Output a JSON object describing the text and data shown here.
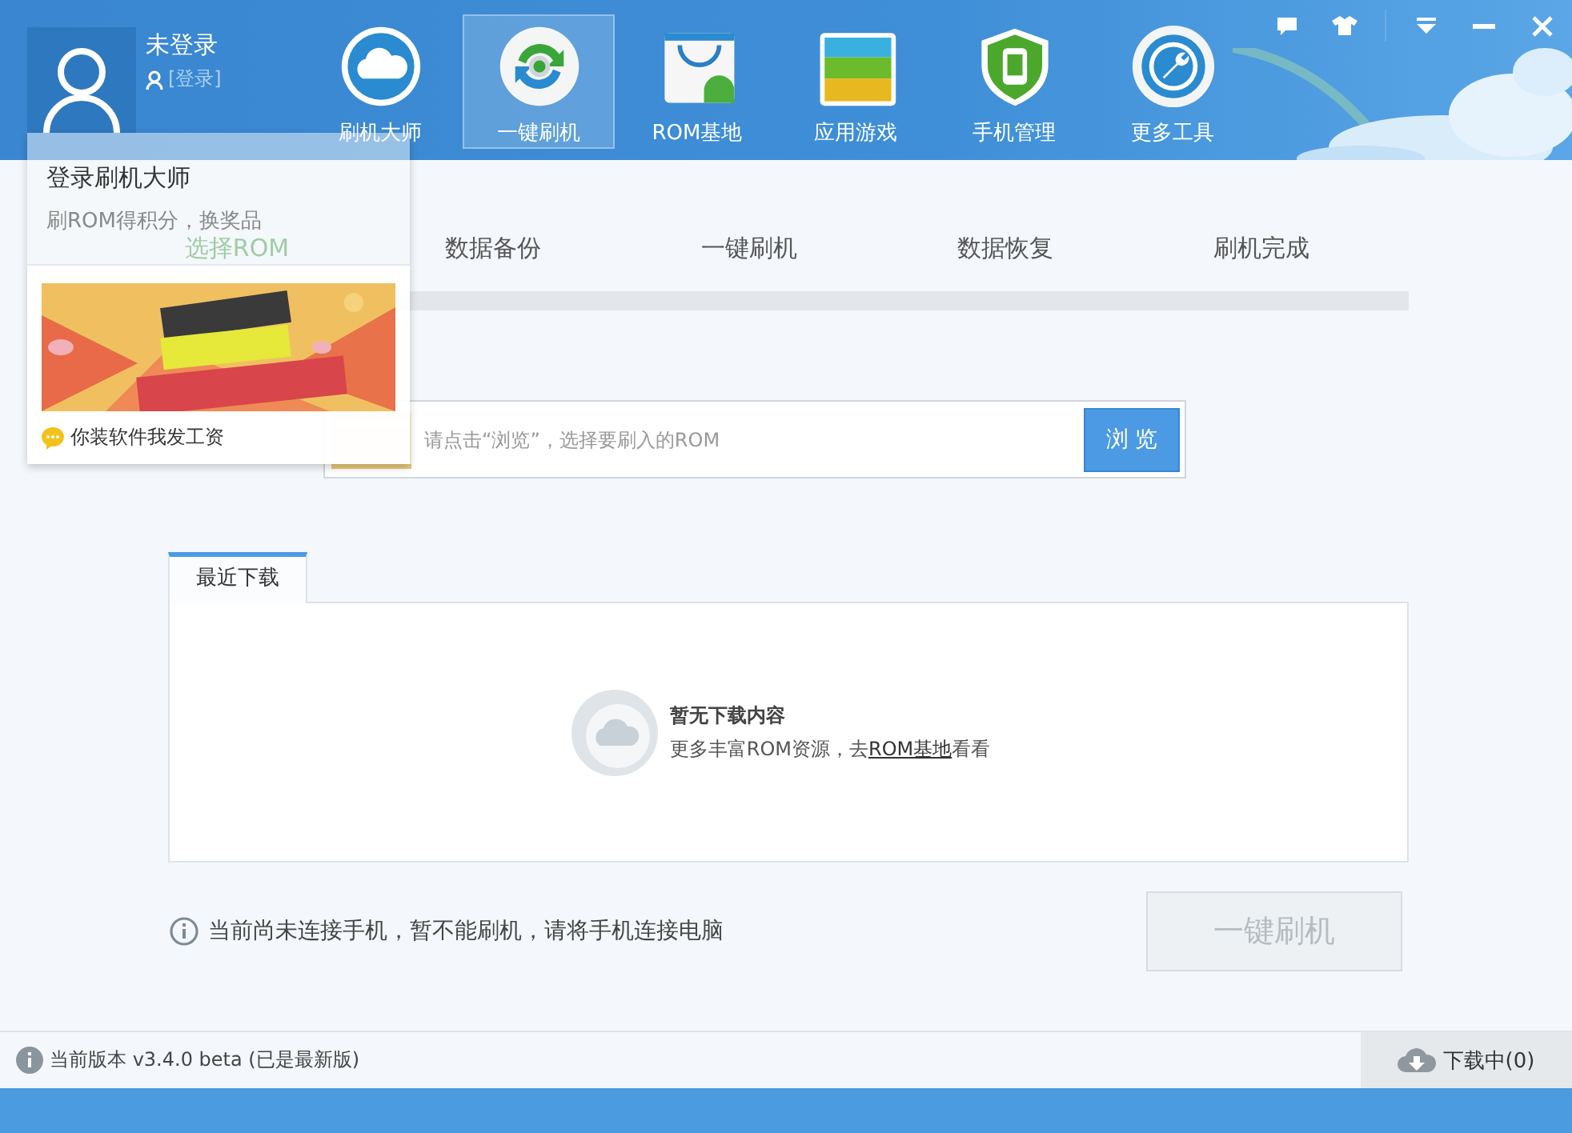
{
  "user": {
    "name": "未登录",
    "login_link": "[登录]"
  },
  "nav": [
    {
      "label": "刷机大师",
      "selected": false
    },
    {
      "label": "一键刷机",
      "selected": true
    },
    {
      "label": "ROM基地",
      "selected": false
    },
    {
      "label": "应用游戏",
      "selected": false
    },
    {
      "label": "手机管理",
      "selected": false
    },
    {
      "label": "更多工具",
      "selected": false
    }
  ],
  "login_popup": {
    "title": "登录刷机大师",
    "subtitle": "刷ROM得积分，换奖品",
    "promo": "你装软件我发工资"
  },
  "steps": [
    {
      "label": "选择ROM",
      "selected": true
    },
    {
      "label": "数据备份",
      "selected": false
    },
    {
      "label": "一键刷机",
      "selected": false
    },
    {
      "label": "数据恢复",
      "selected": false
    },
    {
      "label": "刷机完成",
      "selected": false
    }
  ],
  "rom_picker": {
    "placeholder": "请点击“浏览”，选择要刷入的ROM",
    "button": "浏 览"
  },
  "downloads": {
    "tab": "最近下载",
    "empty_title": "暂无下载内容",
    "empty_hint": "更多丰富ROM资源，去",
    "link": "ROM基地",
    "hint_end": "看看"
  },
  "notice": "当前尚未连接手机，暂不能刷机，请将手机连接电脑",
  "flash_button": {
    "label": "一键刷机",
    "disabled": true
  },
  "status_bar": {
    "version": "当前版本 v3.4.0 beta (已是最新版)",
    "downloading": "下载中(0)"
  }
}
